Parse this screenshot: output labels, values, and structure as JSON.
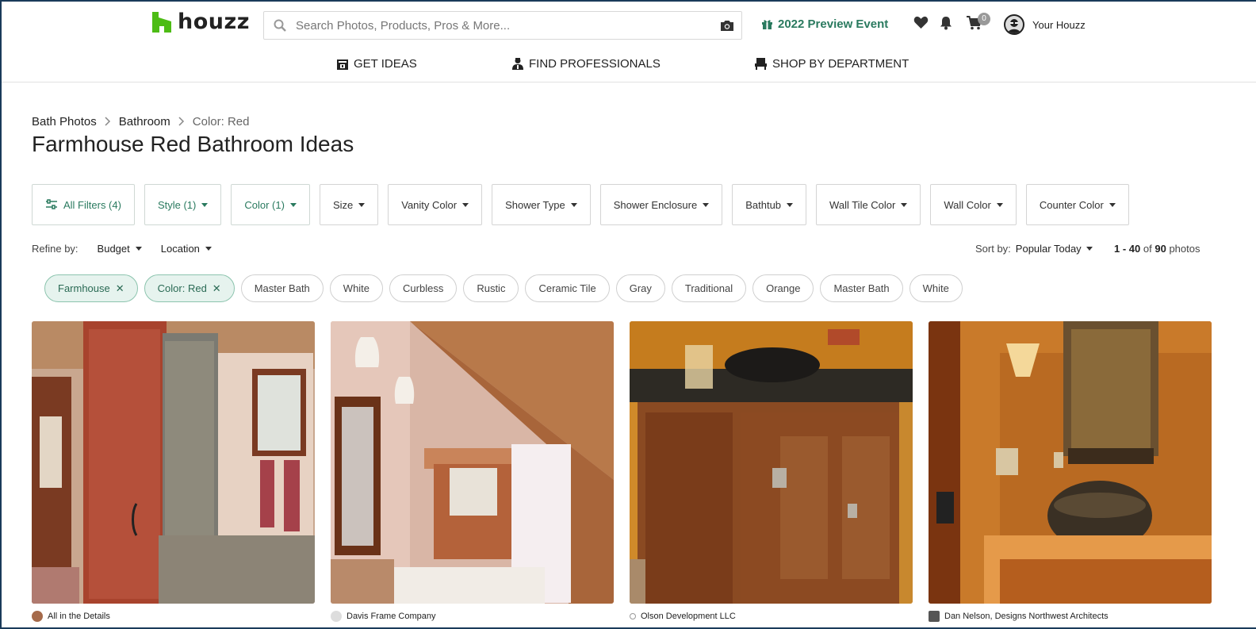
{
  "header": {
    "logo_text": "houzz",
    "search_placeholder": "Search Photos, Products, Pros & More...",
    "preview_event": "2022 Preview Event",
    "cart_count": "0",
    "account_label": "Your Houzz"
  },
  "nav": [
    {
      "label": "GET IDEAS"
    },
    {
      "label": "FIND PROFESSIONALS"
    },
    {
      "label": "SHOP BY DEPARTMENT"
    }
  ],
  "breadcrumb": [
    "Bath Photos",
    "Bathroom",
    "Color: Red"
  ],
  "page_title": "Farmhouse Red Bathroom Ideas",
  "filters": [
    {
      "label": "All Filters (4)",
      "active": true
    },
    {
      "label": "Style (1)",
      "active": true
    },
    {
      "label": "Color (1)",
      "active": true
    },
    {
      "label": "Size",
      "active": false
    },
    {
      "label": "Vanity Color",
      "active": false
    },
    {
      "label": "Shower Type",
      "active": false
    },
    {
      "label": "Shower Enclosure",
      "active": false
    },
    {
      "label": "Bathtub",
      "active": false
    },
    {
      "label": "Wall Tile Color",
      "active": false
    },
    {
      "label": "Wall Color",
      "active": false
    },
    {
      "label": "Counter Color",
      "active": false
    }
  ],
  "refine": {
    "label": "Refine by:",
    "items": [
      "Budget",
      "Location"
    ]
  },
  "sort": {
    "label": "Sort by:",
    "value": "Popular Today"
  },
  "results": {
    "range": "1 - 40",
    "of": "of",
    "total": "90",
    "unit": "photos"
  },
  "chips": [
    {
      "label": "Farmhouse",
      "selected": true
    },
    {
      "label": "Color: Red",
      "selected": true
    },
    {
      "label": "Master Bath",
      "selected": false
    },
    {
      "label": "White",
      "selected": false
    },
    {
      "label": "Curbless",
      "selected": false
    },
    {
      "label": "Rustic",
      "selected": false
    },
    {
      "label": "Ceramic Tile",
      "selected": false
    },
    {
      "label": "Gray",
      "selected": false
    },
    {
      "label": "Traditional",
      "selected": false
    },
    {
      "label": "Orange",
      "selected": false
    },
    {
      "label": "Master Bath",
      "selected": false
    },
    {
      "label": "White",
      "selected": false
    }
  ],
  "photos": [
    {
      "credit": "All in the Details"
    },
    {
      "credit": "Davis Frame Company"
    },
    {
      "credit": "Olson Development LLC"
    },
    {
      "credit": "Dan Nelson, Designs Northwest Architects"
    }
  ],
  "colors": {
    "brand_green": "#4dbc15",
    "accent_green": "#2a7a5f"
  }
}
